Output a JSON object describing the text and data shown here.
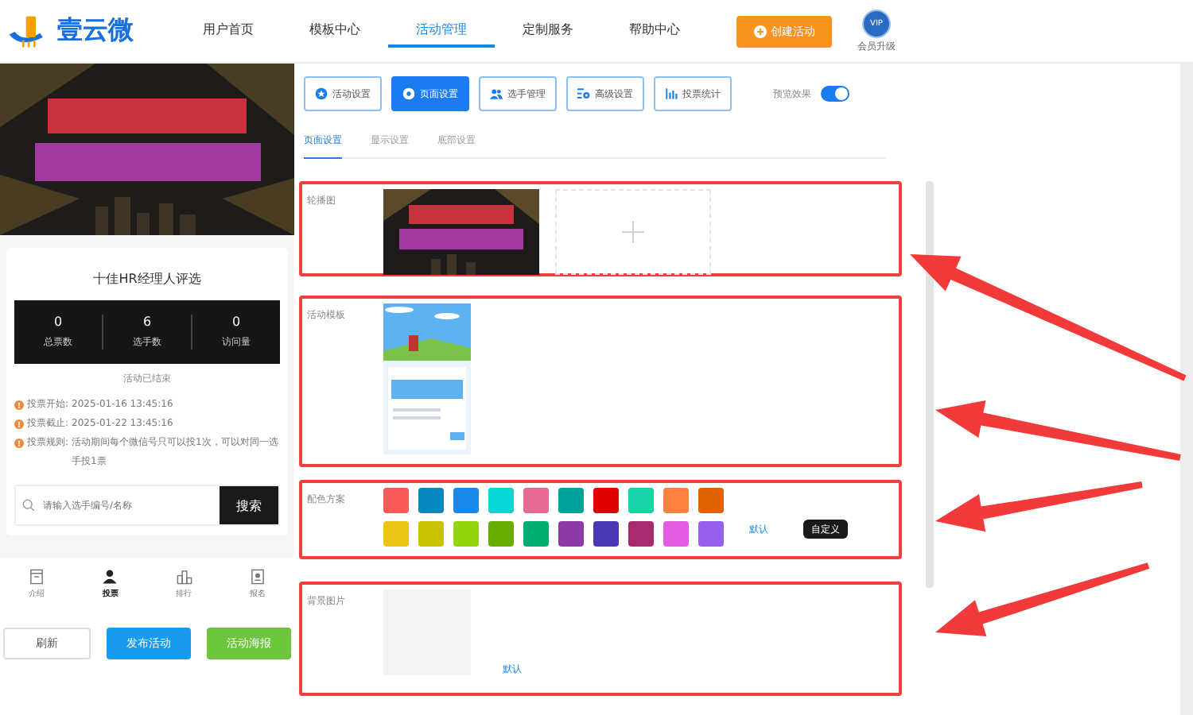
{
  "header": {
    "logo": "壹云微",
    "nav": [
      {
        "label": "用户首页",
        "selected": false
      },
      {
        "label": "模板中心",
        "selected": false
      },
      {
        "label": "活动管理",
        "selected": true
      },
      {
        "label": "定制服务",
        "selected": false
      },
      {
        "label": "帮助中心",
        "selected": false
      }
    ],
    "create_button": "创建活动",
    "vip_badge": "VIP",
    "vip_label": "会员升级"
  },
  "preview": {
    "title": "十佳HR经理人评选",
    "stats": [
      {
        "value": "0",
        "label": "总票数"
      },
      {
        "value": "6",
        "label": "选手数"
      },
      {
        "value": "0",
        "label": "访问量"
      }
    ],
    "status": "活动已结束",
    "info": [
      {
        "label": "投票开始:",
        "text": "2025-01-16 13:45:16"
      },
      {
        "label": "投票截止:",
        "text": "2025-01-22 13:45:16"
      },
      {
        "label": "投票规则:",
        "text": "活动期间每个微信号只可以投1次，可以对同一选手投1票"
      }
    ],
    "search": {
      "placeholder": "请输入选手编号/名称",
      "button": "搜索"
    },
    "tabbar": [
      {
        "label": "介绍",
        "kind": "doc",
        "selected": false
      },
      {
        "label": "投票",
        "kind": "person",
        "selected": true
      },
      {
        "label": "排行",
        "kind": "chart",
        "selected": false
      },
      {
        "label": "报名",
        "kind": "badge",
        "selected": false
      }
    ],
    "actions": [
      {
        "label": "刷新",
        "kind": "plain"
      },
      {
        "label": "发布活动",
        "kind": "primary"
      },
      {
        "label": "活动海报",
        "kind": "success"
      }
    ]
  },
  "toolbar": [
    {
      "label": "活动设置",
      "kind": "star",
      "selected": false
    },
    {
      "label": "页面设置",
      "kind": "gear",
      "selected": true
    },
    {
      "label": "选手管理",
      "kind": "users",
      "selected": false
    },
    {
      "label": "高级设置",
      "kind": "cog",
      "selected": false
    },
    {
      "label": "投票统计",
      "kind": "bars",
      "selected": false
    }
  ],
  "preview_toggle": {
    "label": "预览效果",
    "on": true
  },
  "subtabs": [
    {
      "label": "页面设置",
      "selected": true
    },
    {
      "label": "显示设置",
      "selected": false
    },
    {
      "label": "底部设置",
      "selected": false
    }
  ],
  "sections": [
    {
      "kind": "carousel",
      "label": "轮播图",
      "highlighted": true
    },
    {
      "kind": "template",
      "label": "活动模板",
      "highlighted": true
    },
    {
      "kind": "colors",
      "label": "配色方案",
      "highlighted": true,
      "default_link": "默认",
      "custom_button": "自定义",
      "colors": [
        {
          "color": "#f85a5a"
        },
        {
          "color": "#0a87c0"
        },
        {
          "color": "#1a88ea"
        },
        {
          "color": "#08d6d6"
        },
        {
          "color": "#e66a94"
        },
        {
          "color": "#00a39a"
        },
        {
          "color": "#e00000"
        },
        {
          "color": "#1ad4a8"
        },
        {
          "color": "#fd8240"
        },
        {
          "color": "#dd6400"
        },
        {
          "color": "#ebc416"
        },
        {
          "color": "#c8c200"
        },
        {
          "color": "#94d40c"
        },
        {
          "color": "#66ad00"
        },
        {
          "color": "#00ae72"
        },
        {
          "color": "#8c3aa4"
        },
        {
          "color": "#4b38b4"
        },
        {
          "color": "#a82a70"
        },
        {
          "color": "#e55ce2"
        },
        {
          "color": "#9460ec"
        }
      ]
    },
    {
      "kind": "background",
      "label": "背景图片",
      "highlighted": true,
      "default_link": "默认"
    }
  ]
}
